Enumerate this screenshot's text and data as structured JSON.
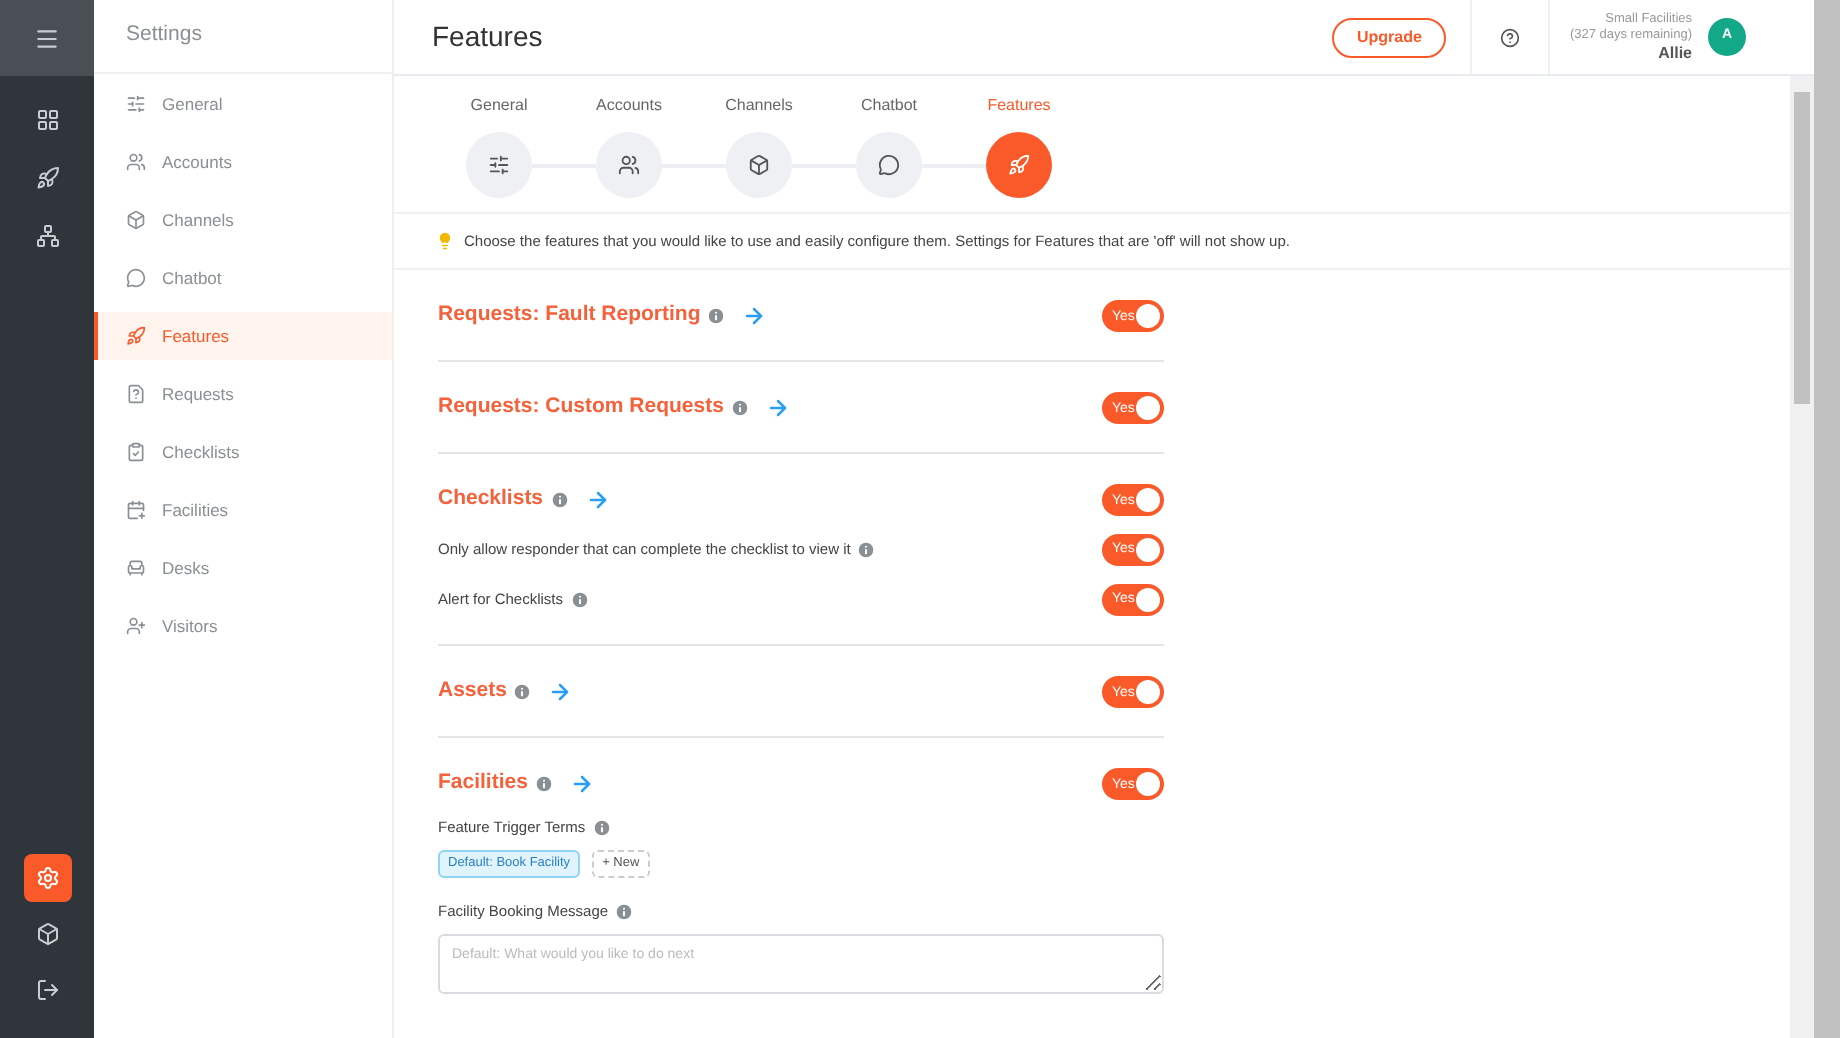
{
  "rail": {
    "top_items": [
      {
        "selected": false
      },
      {
        "selected": false
      },
      {
        "selected": false
      }
    ],
    "bottom_items": [
      {
        "selected": true
      },
      {
        "selected": false
      },
      {
        "selected": false
      }
    ]
  },
  "sidebar": {
    "title": "Settings",
    "items": [
      {
        "label": "General",
        "selected": false
      },
      {
        "label": "Accounts",
        "selected": false
      },
      {
        "label": "Channels",
        "selected": false
      },
      {
        "label": "Chatbot",
        "selected": false
      },
      {
        "label": "Features",
        "selected": true
      },
      {
        "label": "Requests",
        "selected": false
      },
      {
        "label": "Checklists",
        "selected": false
      },
      {
        "label": "Facilities",
        "selected": false
      },
      {
        "label": "Desks",
        "selected": false
      },
      {
        "label": "Visitors",
        "selected": false
      }
    ]
  },
  "header": {
    "title": "Features",
    "upgrade": "Upgrade",
    "account": {
      "plan": "Small Facilities",
      "remaining": "(327 days remaining)",
      "name": "Allie",
      "avatar": "A"
    }
  },
  "steps": [
    {
      "label": "General",
      "selected": false
    },
    {
      "label": "Accounts",
      "selected": false
    },
    {
      "label": "Channels",
      "selected": false
    },
    {
      "label": "Chatbot",
      "selected": false
    },
    {
      "label": "Features",
      "selected": true
    }
  ],
  "tip": "Choose the features that you would like to use and easily configure them. Settings for Features that are 'off' will not show up.",
  "sections": [
    {
      "title": "Requests: Fault Reporting",
      "on": true,
      "toggle": "Yes"
    },
    {
      "title": "Requests: Custom Requests",
      "on": true,
      "toggle": "Yes"
    },
    {
      "title": "Checklists",
      "on": true,
      "toggle": "Yes",
      "options": [
        {
          "label": "Only allow responder that can complete the checklist to view it",
          "on": true,
          "toggle": "Yes"
        },
        {
          "label": "Alert for Checklists",
          "on": true,
          "toggle": "Yes"
        }
      ]
    },
    {
      "title": "Assets",
      "on": true,
      "toggle": "Yes"
    },
    {
      "title": "Facilities",
      "on": true,
      "toggle": "Yes",
      "trigger_terms": {
        "label": "Feature Trigger Terms",
        "tags": [
          "Default: Book Facility"
        ],
        "new_button": "+ New"
      },
      "booking_message": {
        "label": "Facility Booking Message",
        "placeholder": "Default: What would you like to do next"
      }
    }
  ]
}
